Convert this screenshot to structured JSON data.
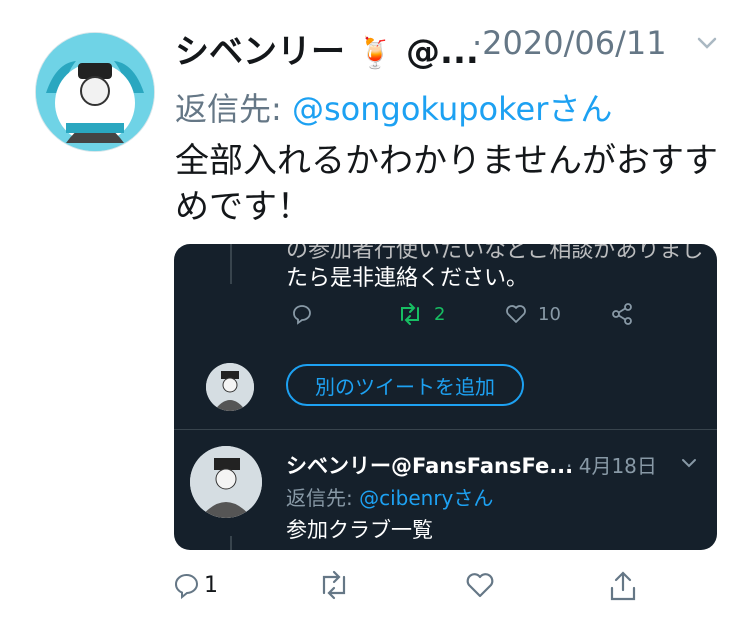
{
  "tweet": {
    "author": "シベンリー",
    "author_emoji": "🍹",
    "author_handle_partial": "@...",
    "date": "·2020/06/11",
    "reply_prefix": "返信先: ",
    "reply_handle": "@songokupokerさん",
    "text": "全部入れるかわかりませんがおすすめです！",
    "reply_count": "1",
    "colors": {
      "accent": "#1da1f2",
      "muted": "#657786",
      "text": "#14171a"
    }
  },
  "embedded": {
    "partial_line": "の参加者行使いたいなどご相談がありまし",
    "line1": "たら是非連絡ください。",
    "retweet_count": "2",
    "like_count": "10",
    "add_tweet_label": "別のツイートを追加",
    "reply_name": "シベンリー@FansFansFe...",
    "reply_date": "· 4月18日",
    "reply_prefix": "返信先: ",
    "reply_handle": "@cibenryさん",
    "reply_body": "参加クラブ一覧",
    "colors": {
      "background": "#15202b",
      "retweet": "#17bf63",
      "muted": "#8899a6"
    }
  }
}
